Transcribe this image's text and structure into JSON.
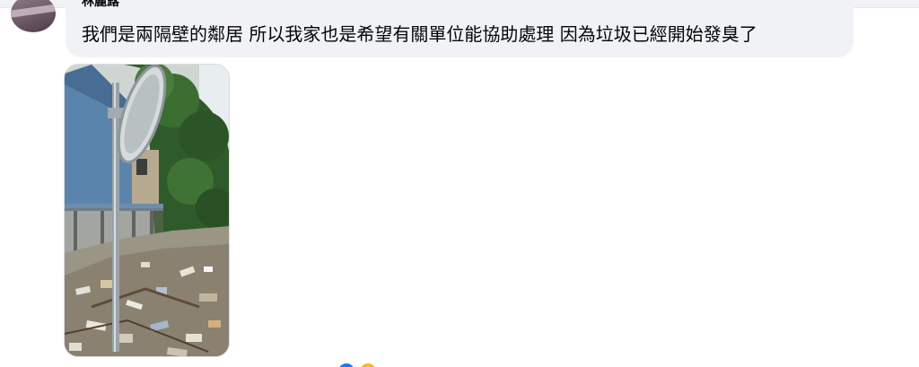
{
  "comment": {
    "author": "林麗蕗",
    "text": "我們是兩隔壁的鄰居 所以我家也是希望有關單位能協助處理 因為垃圾已經開始發臭了"
  },
  "photo": {
    "icon": "photo-of-trash-pile-beside-metal-house"
  },
  "reactions": [
    {
      "icon": "like-icon",
      "color": "#1877f2"
    },
    {
      "icon": "haha-icon",
      "color": "#f7b928"
    }
  ]
}
